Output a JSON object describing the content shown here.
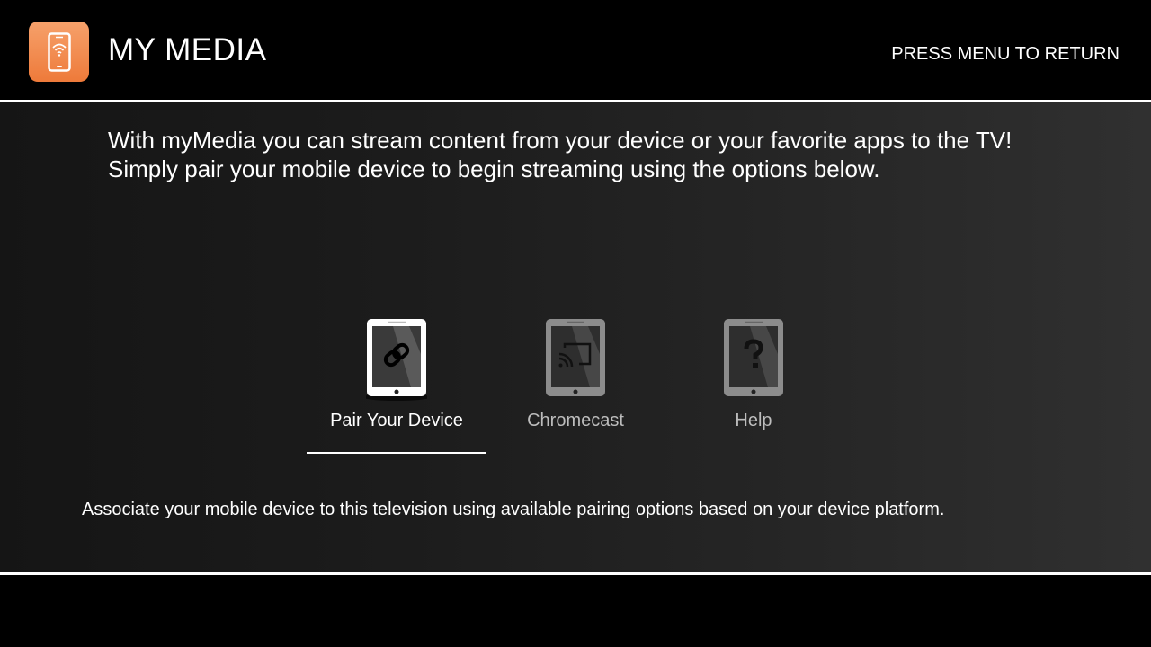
{
  "header": {
    "title": "MY MEDIA",
    "menu_hint": "PRESS MENU TO RETURN",
    "app_icon": "phone-wifi-icon"
  },
  "intro_text": "With myMedia you can stream content from your device or your favorite apps to the TV! Simply pair your mobile device to begin streaming using the options below.",
  "options": [
    {
      "label": "Pair Your Device",
      "icon": "link-icon",
      "selected": true
    },
    {
      "label": "Chromecast",
      "icon": "cast-icon",
      "selected": false
    },
    {
      "label": "Help",
      "icon": "question-icon",
      "selected": false
    }
  ],
  "description": "Associate your mobile device to this television using available pairing options based on your device platform.",
  "colors": {
    "accent_orange": "#ee7a3a",
    "selected_text": "#ffffff",
    "unselected_text": "#bdbdbd",
    "background": "#000000"
  }
}
